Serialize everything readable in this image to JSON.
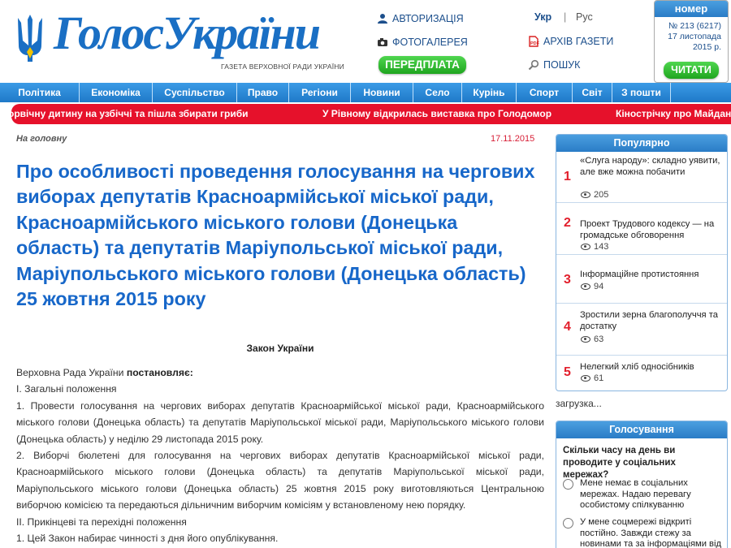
{
  "header": {
    "logo_text": "ГолосУкраїни",
    "logo_subtitle": "ГАЗЕТА ВЕРХОВНОЇ РАДИ УКРАЇНИ",
    "auth_label": "АВТОРИЗАЦІЯ",
    "photo_label": "ФОТОГАЛЕРЕЯ",
    "subscribe_label": "ПЕРЕДПЛАТА",
    "lang_ukr": "Укр",
    "lang_sep": "|",
    "lang_rus": "Рус",
    "archive_label": "АРХІВ ГАЗЕТИ",
    "search_label": "ПОШУК",
    "issue_title": "номер",
    "issue_number": "№ 213 (6217)",
    "issue_date_1": "17 листопада",
    "issue_date_2": "2015 р.",
    "read_label": "ЧИТАТИ"
  },
  "nav": [
    "Політика",
    "Економіка",
    "Суспільство",
    "Право",
    "Регіони",
    "Новини",
    "Село",
    "Курінь",
    "Спорт",
    "Світ",
    "З пошти"
  ],
  "ticker": [
    "орвічну дитину на узбіччі та пішла збирати гриби",
    "У Рівному відкрилась виставка про Голодомор",
    "Кінострічку про Майдан"
  ],
  "article": {
    "breadcrumb": "На головну",
    "date": "17.11.2015",
    "title": "Про особливості проведення голосування на чергових виборах депутатів Красноармійської міської ради, Красноармійського міського голови (Донецька область) та депутатів Маріупольської міської ради, Маріупольського міського голови (Донецька область) 25 жовтня 2015 року",
    "law_type": "Закон України",
    "intro_plain": "Верховна Рада України ",
    "intro_bold": "постановляє:",
    "section1": "І. Загальні положення",
    "p1": "1. Провести голосування на чергових виборах депутатів Красноармійської міської ради, Красноармійського міського голови (Донецька область) та депутатів Маріупольської міської ради, Маріупольського міського голови (Донецька область) у неділю 29 листопада 2015 року.",
    "p2": "2. Виборчі бюлетені для голосування на чергових виборах депутатів Красноармійської міської ради, Красноармійського міського голови (Донецька область) та депутатів Маріупольської міської ради, Маріупольського міського голови (Донецька область) 25 жовтня 2015 року виготовляються Центральною виборчою комісією та передаються дільничним виборчим комісіям у встановленому нею порядку.",
    "section2": "ІІ. Прикінцеві та перехідні положення",
    "p3": "1. Цей Закон набирає чинності з дня його опублікування."
  },
  "popular": {
    "title": "Популярно",
    "items": [
      {
        "num": "1",
        "title": "«Слуга народу»: складно уявити, але вже можна побачити",
        "views": "205"
      },
      {
        "num": "2",
        "title": "Проект Трудового кодексу — на громадське обговорення",
        "views": "143"
      },
      {
        "num": "3",
        "title": "Інформаційне протистояння",
        "views": "94"
      },
      {
        "num": "4",
        "title": "Зростили зерна благополуччя та достатку",
        "views": "63"
      },
      {
        "num": "5",
        "title": "Нелегкий хліб односібників",
        "views": "61"
      }
    ]
  },
  "loading_text": "загрузка...",
  "poll": {
    "title": "Голосування",
    "question": "Скільки часу на день ви проводите у соціальних мережах?",
    "options": [
      "Мене немає в соціальних мережах. Надаю перевагу особистому спілкуванню",
      "У мене соцмережі відкриті постійно. Завжди стежу за новинами та за інформаціями від друзів"
    ]
  },
  "colors": {
    "brand_blue": "#1a6fc4",
    "nav_blue": "#2a86d6",
    "ticker_red": "#e6112b",
    "title_blue": "#1767c9",
    "green_button": "#22a822",
    "accent_red": "#e21f2c"
  }
}
